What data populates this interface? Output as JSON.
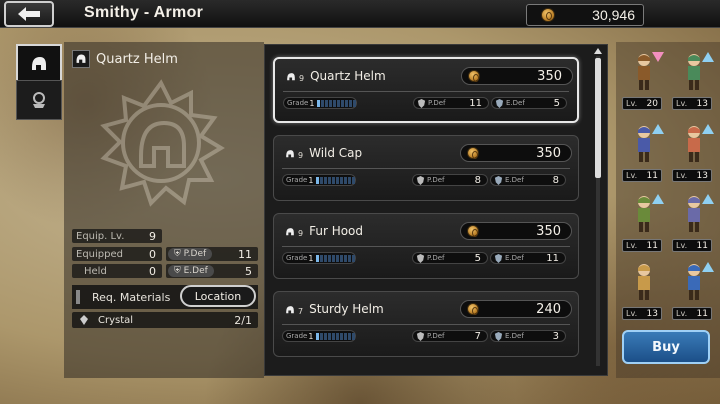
{
  "header": {
    "title": "Smithy - Armor",
    "gold": "30,946"
  },
  "tabs": [
    {
      "name": "helmet",
      "active": true
    },
    {
      "name": "accessory",
      "active": false
    }
  ],
  "detail": {
    "item_name": "Quartz Helm",
    "stats": {
      "equip_lv_label": "Equip. Lv.",
      "equip_lv": "9",
      "equipped_label": "Equipped",
      "equipped": "0",
      "held_label": "Held",
      "held": "0",
      "pdef_label": "P.Def",
      "pdef": "11",
      "edef_label": "E.Def",
      "edef": "5"
    },
    "req_label": "Req. Materials",
    "location_label": "Location",
    "material": {
      "name": "Crystal",
      "count": "2/1"
    }
  },
  "items": [
    {
      "name": "Quartz Helm",
      "qty": "9",
      "price": "350",
      "grade_label": "Grade",
      "grade": "1",
      "pdef_label": "P.Def",
      "pdef": "11",
      "edef_label": "E.Def",
      "edef": "5"
    },
    {
      "name": "Wild Cap",
      "qty": "9",
      "price": "350",
      "grade_label": "Grade",
      "grade": "1",
      "pdef_label": "P.Def",
      "pdef": "8",
      "edef_label": "E.Def",
      "edef": "8"
    },
    {
      "name": "Fur Hood",
      "qty": "9",
      "price": "350",
      "grade_label": "Grade",
      "grade": "1",
      "pdef_label": "P.Def",
      "pdef": "5",
      "edef_label": "E.Def",
      "edef": "11"
    },
    {
      "name": "Sturdy Helm",
      "qty": "7",
      "price": "240",
      "grade_label": "Grade",
      "grade": "1",
      "pdef_label": "P.Def",
      "pdef": "7",
      "edef_label": "E.Def",
      "edef": "3"
    }
  ],
  "party": [
    {
      "lv_label": "Lv.",
      "lv": "20",
      "trend": "down",
      "color": "#8a5a2a"
    },
    {
      "lv_label": "Lv.",
      "lv": "13",
      "trend": "up",
      "color": "#4a8a5a"
    },
    {
      "lv_label": "Lv.",
      "lv": "11",
      "trend": "up",
      "color": "#4a5aa8"
    },
    {
      "lv_label": "Lv.",
      "lv": "13",
      "trend": "up",
      "color": "#c86a4a"
    },
    {
      "lv_label": "Lv.",
      "lv": "11",
      "trend": "up",
      "color": "#6a8a3a"
    },
    {
      "lv_label": "Lv.",
      "lv": "11",
      "trend": "up",
      "color": "#6a6aa8"
    },
    {
      "lv_label": "Lv.",
      "lv": "13",
      "trend": "none",
      "color": "#c89a4a"
    },
    {
      "lv_label": "Lv.",
      "lv": "11",
      "trend": "up",
      "color": "#3a6ab8"
    }
  ],
  "buy_label": "Buy"
}
